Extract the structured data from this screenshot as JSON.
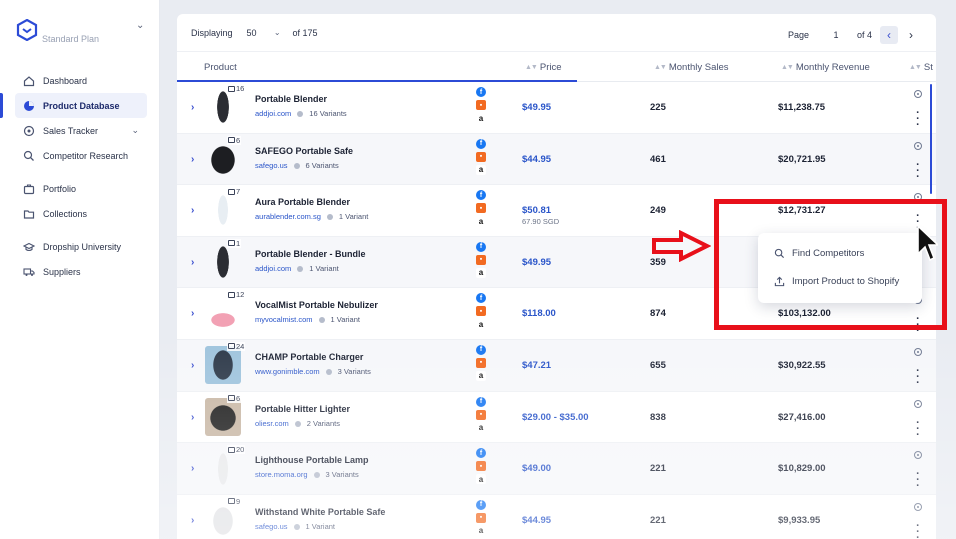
{
  "sidebar": {
    "plan": "Standard Plan",
    "items": [
      {
        "label": "Dashboard",
        "icon": "home-icon"
      },
      {
        "label": "Product Database",
        "icon": "pie-chart-icon",
        "active": true
      },
      {
        "label": "Sales Tracker",
        "icon": "target-icon",
        "has_caret": true
      },
      {
        "label": "Competitor Research",
        "icon": "search-icon"
      },
      {
        "label": "Portfolio",
        "icon": "briefcase-icon"
      },
      {
        "label": "Collections",
        "icon": "folder-icon"
      },
      {
        "label": "Dropship University",
        "icon": "graduation-cap-icon"
      },
      {
        "label": "Suppliers",
        "icon": "truck-icon"
      }
    ]
  },
  "toolbar": {
    "displaying_label": "Displaying",
    "per_page": "50",
    "of_total": "of 175",
    "page_label": "Page",
    "page_value": "1",
    "of_pages": "of 4"
  },
  "columns": {
    "product": "Product",
    "price": "Price",
    "monthly_sales": "Monthly Sales",
    "monthly_revenue": "Monthly Revenue",
    "status_partial": "St"
  },
  "rows": [
    {
      "name": "Portable Blender",
      "store": "addjoi.com",
      "variants": "16 Variants",
      "images": "16",
      "price": "$49.95",
      "price_sub": "",
      "sales": "225",
      "revenue": "$11,238.75"
    },
    {
      "name": "SAFEGO Portable Safe",
      "store": "safego.us",
      "variants": "6 Variants",
      "images": "6",
      "price": "$44.95",
      "price_sub": "",
      "sales": "461",
      "revenue": "$20,721.95"
    },
    {
      "name": "Aura Portable Blender",
      "store": "aurablender.com.sg",
      "variants": "1 Variant",
      "images": "7",
      "price": "$50.81",
      "price_sub": "67.90 SGD",
      "sales": "249",
      "revenue": "$12,731.27"
    },
    {
      "name": "Portable Blender - Bundle",
      "store": "addjoi.com",
      "variants": "1 Variant",
      "images": "1",
      "price": "$49.95",
      "price_sub": "",
      "sales": "359",
      "revenue": ""
    },
    {
      "name": "VocalMist Portable Nebulizer",
      "store": "myvocalmist.com",
      "variants": "1 Variant",
      "images": "12",
      "price": "$118.00",
      "price_sub": "",
      "sales": "874",
      "revenue": "$103,132.00"
    },
    {
      "name": "CHAMP Portable Charger",
      "store": "www.gonimble.com",
      "variants": "3 Variants",
      "images": "24",
      "price": "$47.21",
      "price_sub": "",
      "sales": "655",
      "revenue": "$30,922.55"
    },
    {
      "name": "Portable Hitter Lighter",
      "store": "oliesr.com",
      "variants": "2 Variants",
      "images": "6",
      "price": "$29.00 - $35.00",
      "price_sub": "",
      "sales": "838",
      "revenue": "$27,416.00"
    },
    {
      "name": "Lighthouse Portable Lamp",
      "store": "store.moma.org",
      "variants": "3 Variants",
      "images": "20",
      "price": "$49.00",
      "price_sub": "",
      "sales": "221",
      "revenue": "$10,829.00"
    },
    {
      "name": "Withstand White Portable Safe",
      "store": "safego.us",
      "variants": "1 Variant",
      "images": "9",
      "price": "$44.95",
      "price_sub": "",
      "sales": "221",
      "revenue": "$9,933.95"
    }
  ],
  "menu": {
    "find_competitors": "Find Competitors",
    "import_product": "Import Product to Shopify"
  },
  "colors": {
    "accent": "#2c4bd6",
    "link": "#2a55c9",
    "annotation_red": "#e8101a"
  }
}
